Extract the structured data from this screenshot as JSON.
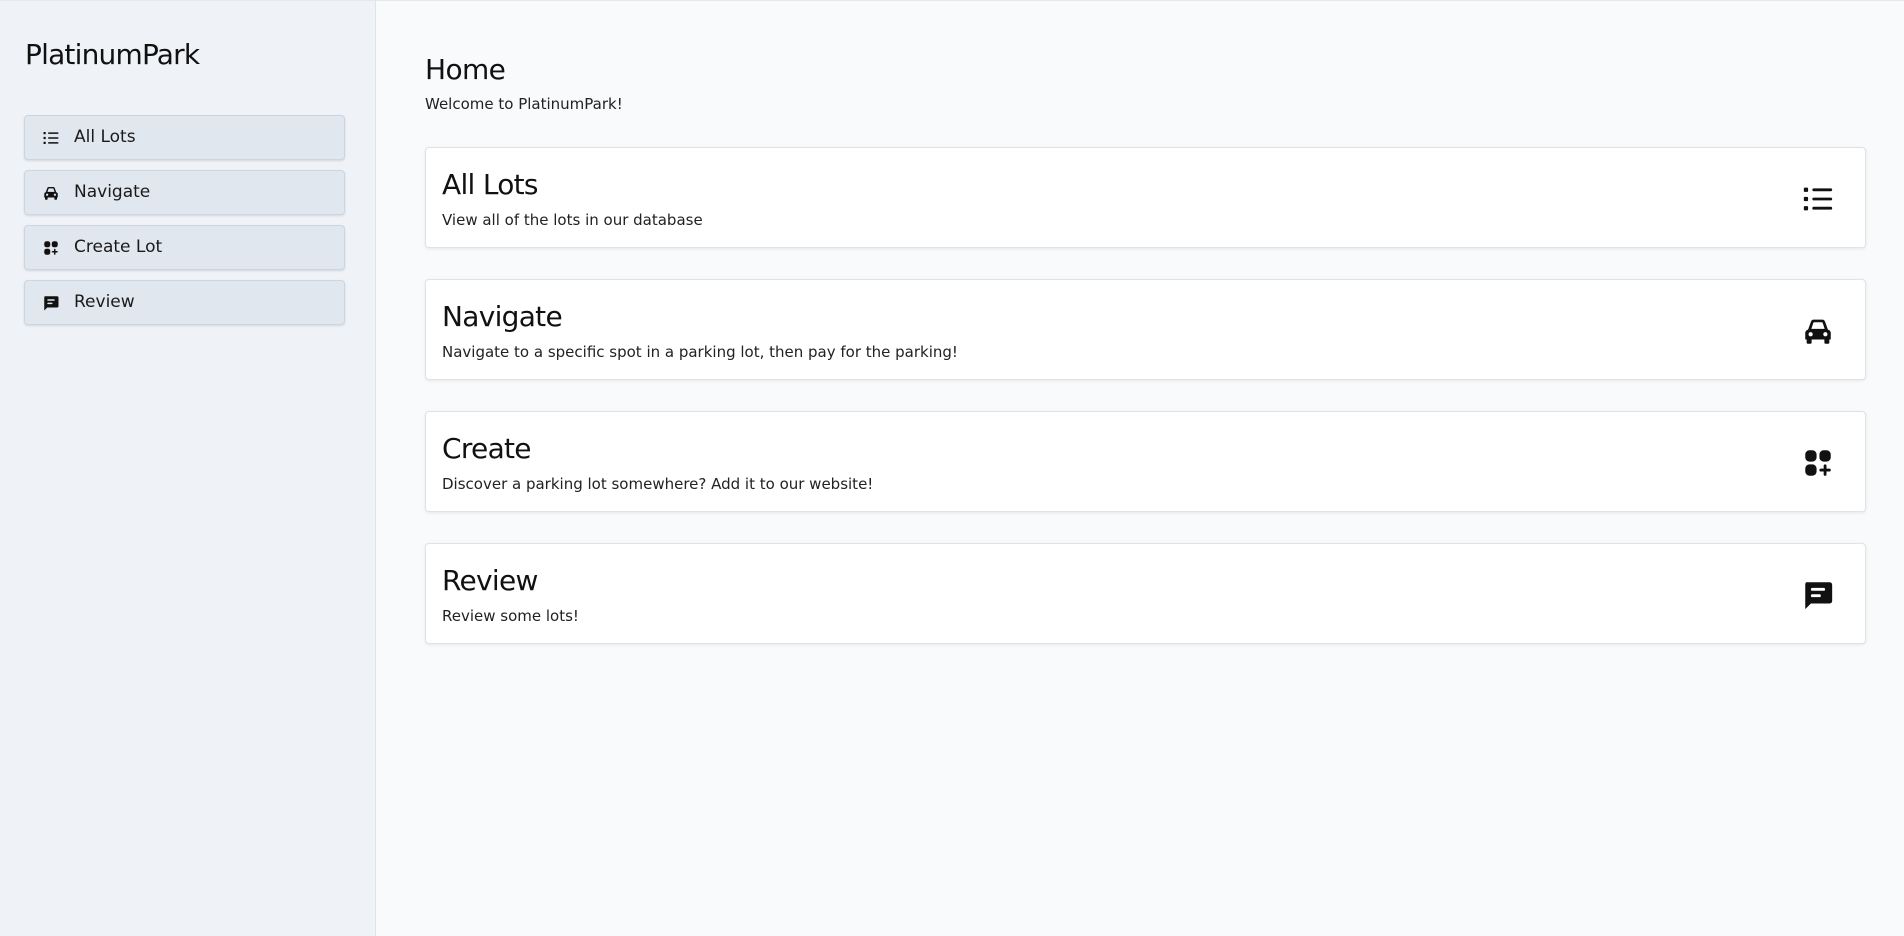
{
  "app": {
    "brand": "PlatinumPark"
  },
  "sidebar": {
    "items": [
      {
        "label": "All Lots",
        "icon": "list-icon"
      },
      {
        "label": "Navigate",
        "icon": "car-icon"
      },
      {
        "label": "Create Lot",
        "icon": "add-grid-icon"
      },
      {
        "label": "Review",
        "icon": "chat-icon"
      }
    ]
  },
  "main": {
    "title": "Home",
    "subtitle": "Welcome to PlatinumPark!",
    "cards": [
      {
        "title": "All Lots",
        "description": "View all of the lots in our database",
        "icon": "list-icon"
      },
      {
        "title": "Navigate",
        "description": "Navigate to a specific spot in a parking lot, then pay for the parking!",
        "icon": "car-icon"
      },
      {
        "title": "Create",
        "description": "Discover a parking lot somewhere? Add it to our website!",
        "icon": "add-grid-icon"
      },
      {
        "title": "Review",
        "description": "Review some lots!",
        "icon": "chat-icon"
      }
    ]
  },
  "colors": {
    "sidebar_bg": "#eff3f8",
    "nav_item_bg": "#e1e7ef",
    "main_bg": "#f9fafb",
    "card_bg": "#ffffff",
    "text": "#111111"
  }
}
